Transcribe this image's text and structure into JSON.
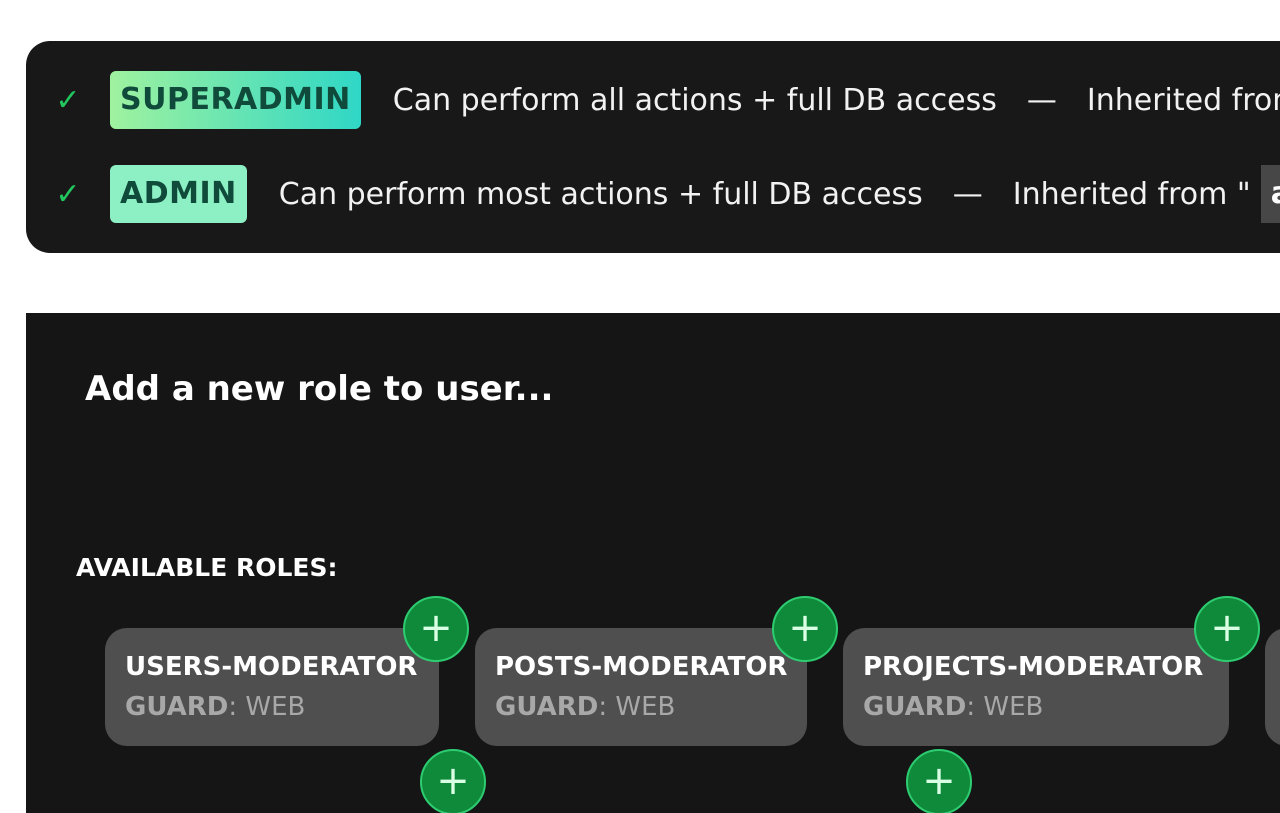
{
  "assigned_roles": [
    {
      "badge": "SUPERADMIN",
      "description": "Can perform all actions + full DB access",
      "separator": "—",
      "inherited_text": "Inherited from \""
    },
    {
      "badge": "ADMIN",
      "description": "Can perform most actions + full DB access",
      "separator": "—",
      "inherited_text": "Inherited from \"",
      "inherited_source": "admi"
    }
  ],
  "add_role": {
    "title": "Add a new role to user...",
    "available_label": "AVAILABLE ROLES:",
    "roles": [
      {
        "name": "USERS-MODERATOR",
        "guard_label": "GUARD",
        "guard_value": ": WEB"
      },
      {
        "name": "POSTS-MODERATOR",
        "guard_label": "GUARD",
        "guard_value": ": WEB"
      },
      {
        "name": "PROJECTS-MODERATOR",
        "guard_label": "GUARD",
        "guard_value": ": WEB"
      }
    ],
    "add_symbol": "+"
  },
  "colors": {
    "panel_bg": "#181818",
    "check": "#22c55e",
    "badge_text": "#0f4a3a",
    "card_bg": "#4f4f4f",
    "add_button": "#0f8a3a"
  }
}
